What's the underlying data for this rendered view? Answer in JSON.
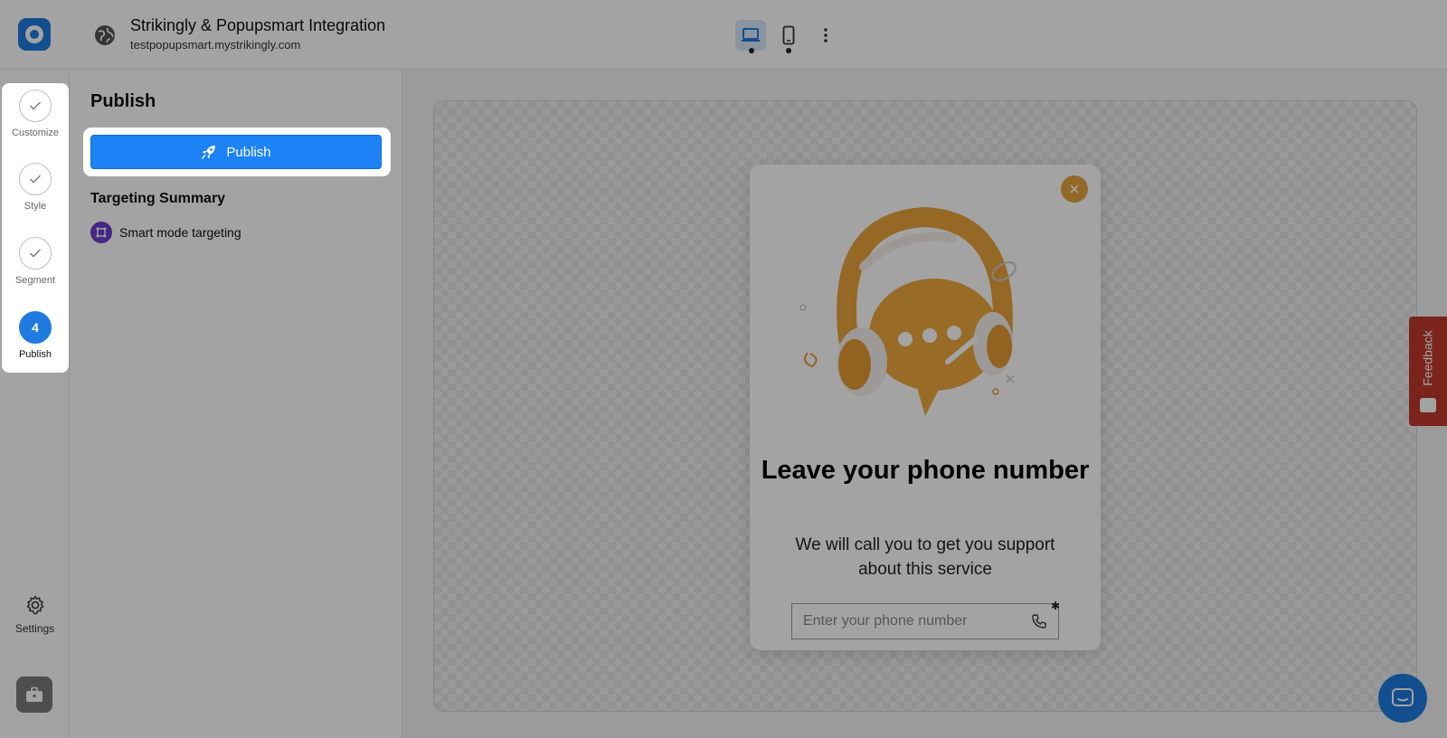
{
  "header": {
    "site_title": "Strikingly & Popupsmart Integration",
    "site_url": "testpopupsmart.mystrikingly.com"
  },
  "steps": [
    {
      "label": "Customize",
      "state": "done"
    },
    {
      "label": "Style",
      "state": "done"
    },
    {
      "label": "Segment",
      "state": "done"
    },
    {
      "label": "Publish",
      "state": "active",
      "number": "4"
    }
  ],
  "settings": {
    "label": "Settings"
  },
  "panel": {
    "heading": "Publish",
    "publish_button": "Publish",
    "targeting_title": "Targeting Summary",
    "targeting_item": "Smart mode targeting"
  },
  "popup": {
    "title": "Leave your phone number",
    "subtitle": "We will call you to get you support about this service",
    "input_placeholder": "Enter your phone number",
    "accent_color": "#e8a33c"
  },
  "feedback": {
    "label": "Feedback"
  },
  "colors": {
    "primary": "#1d82f5",
    "targeting_icon": "#6d3fd0",
    "feedback": "#c0392b"
  }
}
